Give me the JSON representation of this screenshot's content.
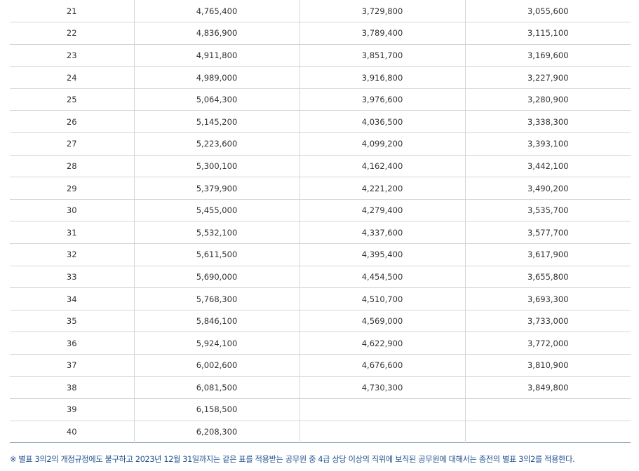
{
  "table": {
    "rows": [
      {
        "step": "21",
        "c1": "4,765,400",
        "c2": "3,729,800",
        "c3": "3,055,600"
      },
      {
        "step": "22",
        "c1": "4,836,900",
        "c2": "3,789,400",
        "c3": "3,115,100"
      },
      {
        "step": "23",
        "c1": "4,911,800",
        "c2": "3,851,700",
        "c3": "3,169,600"
      },
      {
        "step": "24",
        "c1": "4,989,000",
        "c2": "3,916,800",
        "c3": "3,227,900"
      },
      {
        "step": "25",
        "c1": "5,064,300",
        "c2": "3,976,600",
        "c3": "3,280,900"
      },
      {
        "step": "26",
        "c1": "5,145,200",
        "c2": "4,036,500",
        "c3": "3,338,300"
      },
      {
        "step": "27",
        "c1": "5,223,600",
        "c2": "4,099,200",
        "c3": "3,393,100"
      },
      {
        "step": "28",
        "c1": "5,300,100",
        "c2": "4,162,400",
        "c3": "3,442,100"
      },
      {
        "step": "29",
        "c1": "5,379,900",
        "c2": "4,221,200",
        "c3": "3,490,200"
      },
      {
        "step": "30",
        "c1": "5,455,000",
        "c2": "4,279,400",
        "c3": "3,535,700"
      },
      {
        "step": "31",
        "c1": "5,532,100",
        "c2": "4,337,600",
        "c3": "3,577,700"
      },
      {
        "step": "32",
        "c1": "5,611,500",
        "c2": "4,395,400",
        "c3": "3,617,900"
      },
      {
        "step": "33",
        "c1": "5,690,000",
        "c2": "4,454,500",
        "c3": "3,655,800"
      },
      {
        "step": "34",
        "c1": "5,768,300",
        "c2": "4,510,700",
        "c3": "3,693,300"
      },
      {
        "step": "35",
        "c1": "5,846,100",
        "c2": "4,569,000",
        "c3": "3,733,000"
      },
      {
        "step": "36",
        "c1": "5,924,100",
        "c2": "4,622,900",
        "c3": "3,772,000"
      },
      {
        "step": "37",
        "c1": "6,002,600",
        "c2": "4,676,600",
        "c3": "3,810,900"
      },
      {
        "step": "38",
        "c1": "6,081,500",
        "c2": "4,730,300",
        "c3": "3,849,800"
      },
      {
        "step": "39",
        "c1": "6,158,500",
        "c2": "",
        "c3": ""
      },
      {
        "step": "40",
        "c1": "6,208,300",
        "c2": "",
        "c3": ""
      }
    ]
  },
  "footnote": "※ 별표 3의2의 개정규정에도 불구하고 2023년 12월 31일까지는 같은 표를 적용받는 공무원 중 4급 상당 이상의 직위에 보직된 공무원에 대해서는 종전의 별표 3의2를 적용한다.",
  "colors": {
    "text": "#333333",
    "grid": "#d2d6db",
    "footnote": "#1f4e8c"
  }
}
